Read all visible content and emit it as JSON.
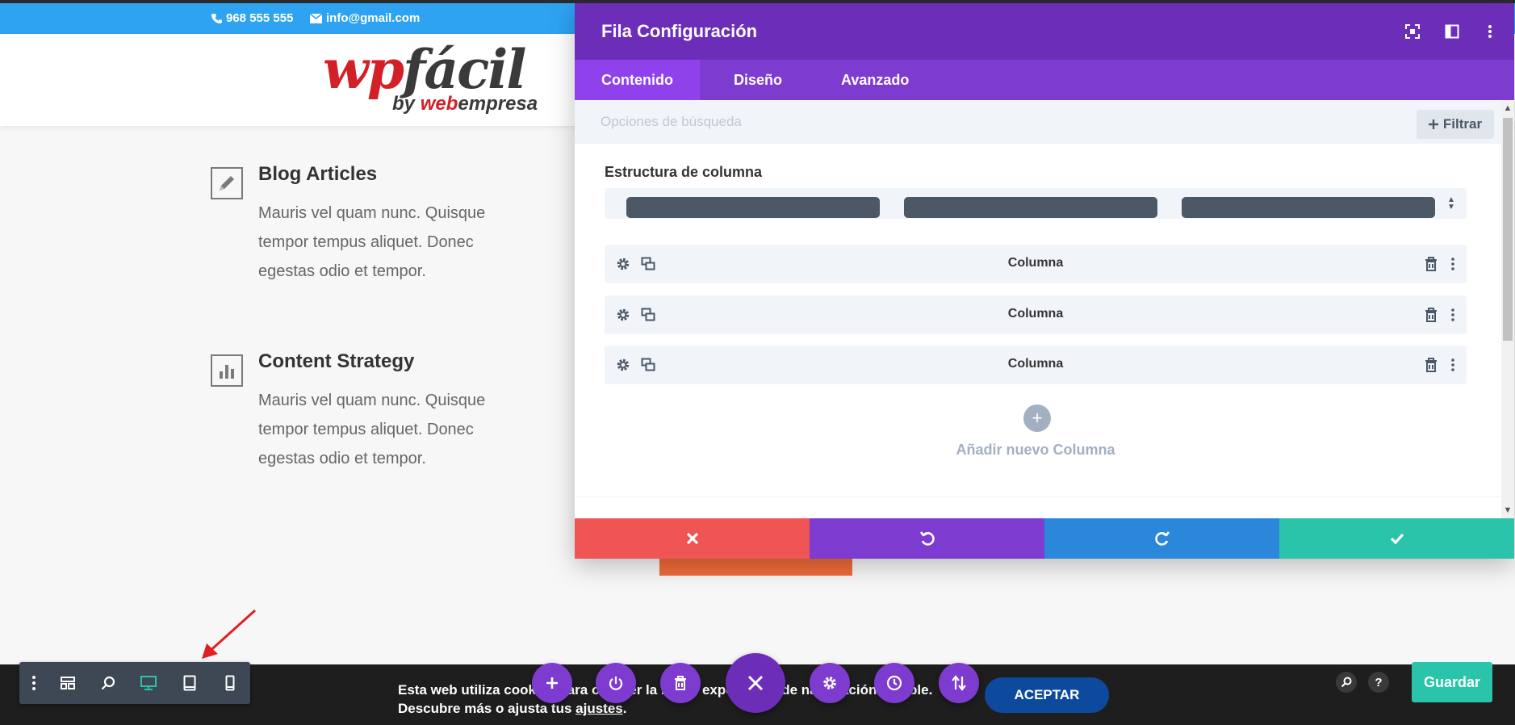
{
  "site": {
    "contact": {
      "phone": "968 555 555",
      "email": "info@gmail.com"
    },
    "logo": {
      "main_part1": "wp",
      "main_part2": "fácil",
      "by": "by ",
      "brand1": "web",
      "brand2": "empresa"
    },
    "features": [
      {
        "title": "Blog Articles",
        "text": "Mauris vel quam nunc. Quisque tempor tempus aliquet. Donec egestas odio et tempor.",
        "icon": "pencil-icon"
      },
      {
        "title": "Content Strategy",
        "text": "Mauris vel quam nunc. Quisque tempor tempus aliquet. Donec egestas odio et tempor.",
        "icon": "bar-chart-icon"
      }
    ]
  },
  "modal": {
    "title": "Fila Configuración",
    "tabs": [
      {
        "label": "Contenido",
        "active": true
      },
      {
        "label": "Diseño",
        "active": false
      },
      {
        "label": "Avanzado",
        "active": false
      }
    ],
    "search_placeholder": "Opciones de búsqueda",
    "filter_label": "Filtrar",
    "structure_label": "Estructura de columna",
    "columns": [
      {
        "label": "Columna"
      },
      {
        "label": "Columna"
      },
      {
        "label": "Columna"
      }
    ],
    "add_column_label": "Añadir nuevo Columna",
    "footer": [
      {
        "action": "discard",
        "icon": "close-icon",
        "color": "#ef5555"
      },
      {
        "action": "undo",
        "icon": "undo-icon",
        "color": "#7e3bd0"
      },
      {
        "action": "redo",
        "icon": "redo-icon",
        "color": "#2b87da"
      },
      {
        "action": "save",
        "icon": "check-icon",
        "color": "#29c4a9"
      }
    ]
  },
  "cookie": {
    "line1": "Esta web utiliza cookies para obtener la mejor experiencia de navegación posible.",
    "line2_prefix": "Descubre más o ajusta tus ",
    "line2_link": "ajustes",
    "line2_suffix": ".",
    "accept_label": "ACEPTAR"
  },
  "builder_bar": {
    "save_label": "Guardar",
    "help_label": "?",
    "view_modes": [
      "menu-icon",
      "layout-icon",
      "zoom-icon",
      "desktop-icon",
      "tablet-icon",
      "phone-icon"
    ],
    "active_view": "desktop",
    "page_actions": [
      "plus-icon",
      "power-icon",
      "trash-icon",
      "close-icon",
      "gear-icon",
      "history-icon",
      "sort-icon"
    ]
  },
  "colors": {
    "modal_header": "#6c2eb9",
    "modal_tabs": "#7e3bd0",
    "active_tab": "#8f42ec",
    "contact_bar": "#2ea3f2",
    "save_button": "#29c4a9",
    "accept_button": "#0d4a9e"
  }
}
